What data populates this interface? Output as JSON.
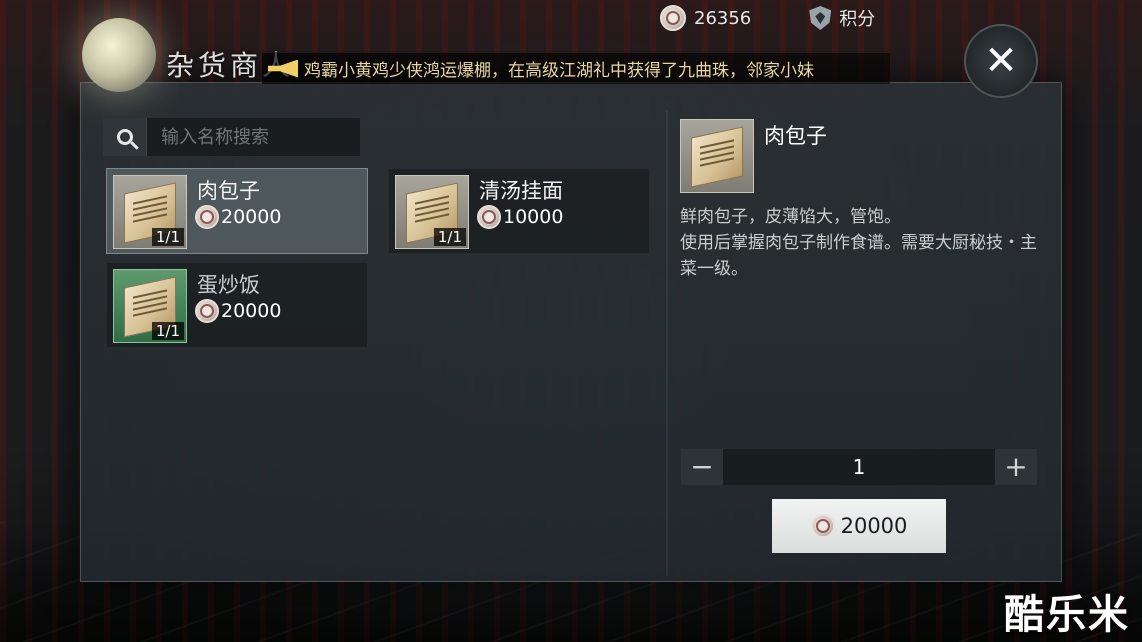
{
  "currency": {
    "coins": "26356",
    "points_label": "积分"
  },
  "shop": {
    "title": "杂货商人",
    "marquee": "鸡霸小黄鸡少侠鸿运爆棚，在高级江湖礼中获得了九曲珠，邻家小妹",
    "search_placeholder": "输入名称搜索"
  },
  "items": [
    {
      "name": "肉包子",
      "price": "20000",
      "count": "1/1"
    },
    {
      "name": "清汤挂面",
      "price": "10000",
      "count": "1/1"
    },
    {
      "name": "蛋炒饭",
      "price": "20000",
      "count": "1/1"
    }
  ],
  "detail": {
    "name": "肉包子",
    "desc_line1": "鲜肉包子，皮薄馅大，管饱。",
    "desc_line2": "使用后掌握肉包子制作食谱。需要大厨秘技・主菜一级。",
    "quantity": "1",
    "minus": "−",
    "plus": "+",
    "total_price": "20000"
  },
  "close_label": "✕",
  "watermark": "酷乐米",
  "colors": {
    "marquee_text": "#e8d7a3",
    "selected_bg": "#555f64",
    "green_tile": "#2f6e45"
  }
}
